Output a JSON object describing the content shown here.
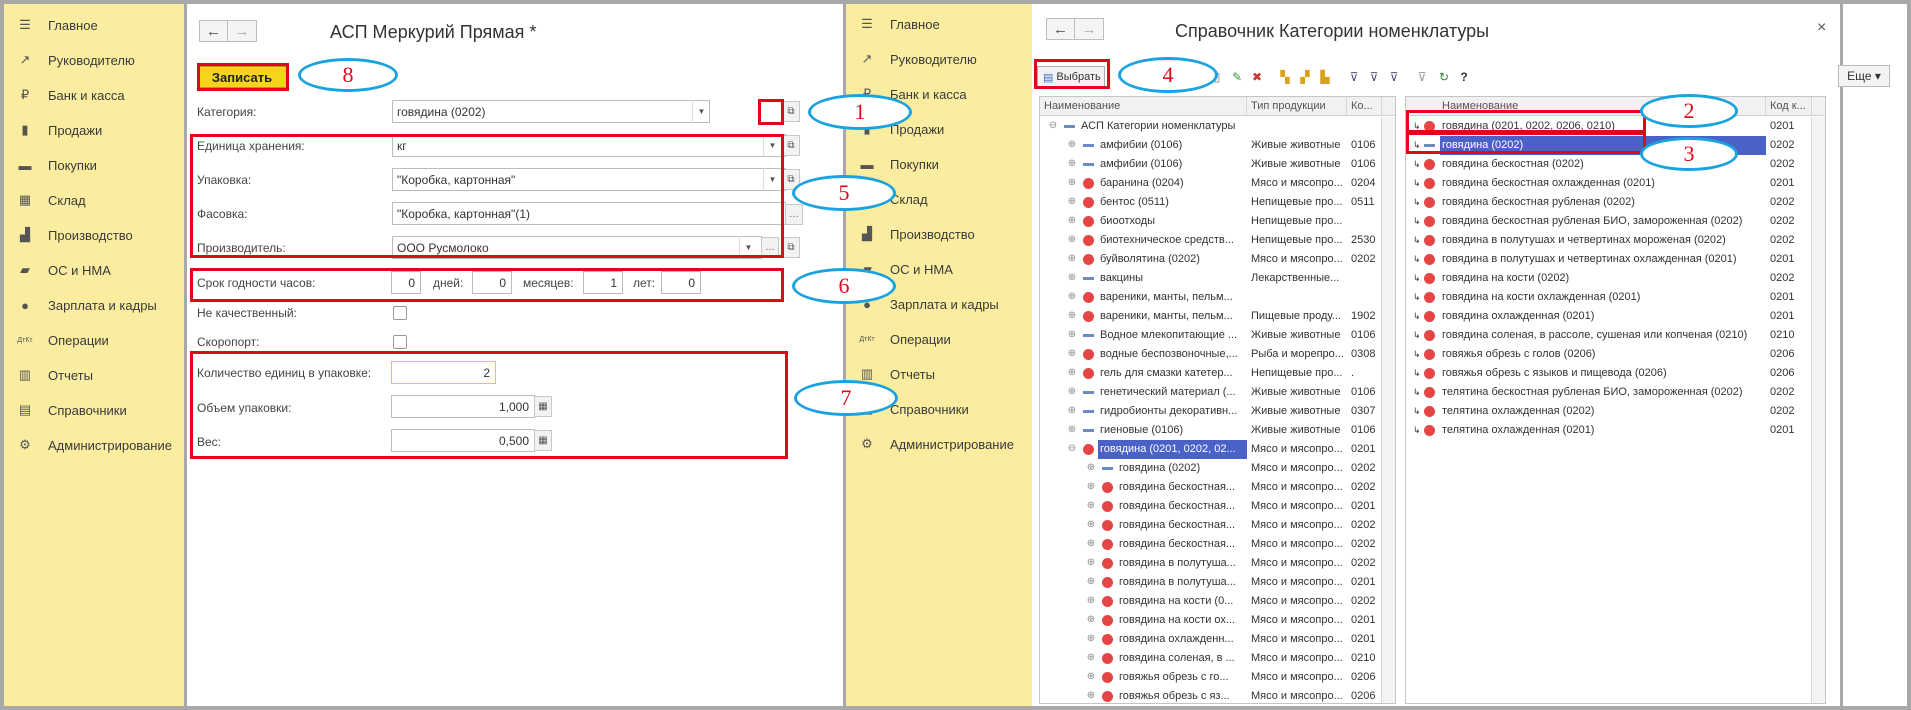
{
  "left_sidebar": {
    "items": [
      {
        "icon": "menu-icon",
        "glyph": "☰",
        "label": "Главное"
      },
      {
        "icon": "chart-trend-icon",
        "glyph": "↗",
        "label": "Руководителю"
      },
      {
        "icon": "coin-icon",
        "glyph": "₽",
        "label": "Банк и касса"
      },
      {
        "icon": "bag-icon",
        "glyph": "▮",
        "label": "Продажи"
      },
      {
        "icon": "cart-icon",
        "glyph": "▬",
        "label": "Покупки"
      },
      {
        "icon": "grid-icon",
        "glyph": "▦",
        "label": "Склад"
      },
      {
        "icon": "factory-icon",
        "glyph": "▟",
        "label": "Производство"
      },
      {
        "icon": "truck-icon",
        "glyph": "▰",
        "label": "ОС и НМА"
      },
      {
        "icon": "person-icon",
        "glyph": "●",
        "label": "Зарплата и кадры"
      },
      {
        "icon": "dt-kt-icon",
        "glyph": "ДтКт",
        "label": "Операции"
      },
      {
        "icon": "bar-chart-icon",
        "glyph": "▥",
        "label": "Отчеты"
      },
      {
        "icon": "book-icon",
        "glyph": "▤",
        "label": "Справочники"
      },
      {
        "icon": "gear-icon",
        "glyph": "⚙",
        "label": "Администрирование"
      }
    ]
  },
  "form": {
    "title": "АСП Меркурий Прямая *",
    "save_label": "Записать",
    "category_label": "Категория:",
    "category_value": "говядина (0202)",
    "unit_label": "Единица хранения:",
    "unit_value": "кг",
    "package_label": "Упаковка:",
    "package_value": "\"Коробка, картонная\"",
    "packing_label": "Фасовка:",
    "packing_value": "\"Коробка, картонная\"(1)",
    "producer_label": "Производитель:",
    "producer_value": "ООО Русмолоко",
    "shelf_label": "Срок годности часов:",
    "shelf_hours": "0",
    "days_label": "дней:",
    "days_value": "0",
    "months_label": "месяцев:",
    "months_value": "1",
    "years_label": "лет:",
    "years_value": "0",
    "not_quality_label": "Не качественный:",
    "perishable_label": "Скоропорт:",
    "qty_label": "Количество единиц в упаковке:",
    "qty_value": "2",
    "volume_label": "Объем упаковки:",
    "volume_value": "1,000",
    "weight_label": "Вес:",
    "weight_value": "0,500"
  },
  "dialog": {
    "title": "Справочник Категории номенклатуры",
    "close": "×",
    "select_label": "Выбрать",
    "help": "?",
    "more_label": "Еще ▾",
    "left_table": {
      "headers": [
        "Наименование",
        "Тип продукции",
        "Ко..."
      ],
      "rows": [
        {
          "name": "АСП Категории номенклатуры",
          "type": "",
          "code": "",
          "level": 0,
          "kind": "root"
        },
        {
          "name": "амфибии (0106)",
          "type": "Живые животные",
          "code": "0106",
          "level": 1,
          "kind": "dash"
        },
        {
          "name": "амфибии (0106)",
          "type": "Живые животные",
          "code": "0106",
          "level": 1,
          "kind": "dash"
        },
        {
          "name": "баранина (0204)",
          "type": "Мясо и мясопро...",
          "code": "0204",
          "level": 1,
          "kind": "red"
        },
        {
          "name": "бентос (0511)",
          "type": "Непищевые про...",
          "code": "0511",
          "level": 1,
          "kind": "red"
        },
        {
          "name": "биоотходы",
          "type": "Непищевые про...",
          "code": "",
          "level": 1,
          "kind": "red"
        },
        {
          "name": "биотехническое средств...",
          "type": "Непищевые про...",
          "code": "2530",
          "level": 1,
          "kind": "red"
        },
        {
          "name": "буйволятина (0202)",
          "type": "Мясо и мясопро...",
          "code": "0202",
          "level": 1,
          "kind": "red"
        },
        {
          "name": "вакцины",
          "type": "Лекарственные...",
          "code": "",
          "level": 1,
          "kind": "dash"
        },
        {
          "name": "вареники, манты, пельм...",
          "type": "",
          "code": "",
          "level": 1,
          "kind": "red"
        },
        {
          "name": "вареники, манты, пельм...",
          "type": "Пищевые проду...",
          "code": "1902",
          "level": 1,
          "kind": "red"
        },
        {
          "name": "Водное млекопитающие ...",
          "type": "Живые животные",
          "code": "0106",
          "level": 1,
          "kind": "dash"
        },
        {
          "name": "водные беспозвоночные,...",
          "type": "Рыба и морепро...",
          "code": "0308",
          "level": 1,
          "kind": "red"
        },
        {
          "name": "гель для смазки катетер...",
          "type": "Непищевые про...",
          "code": ".",
          "level": 1,
          "kind": "red"
        },
        {
          "name": "генетический материал (...",
          "type": "Живые животные",
          "code": "0106",
          "level": 1,
          "kind": "dash"
        },
        {
          "name": "гидробионты декоративн...",
          "type": "Живые животные",
          "code": "0307",
          "level": 1,
          "kind": "dash"
        },
        {
          "name": "гиеновые (0106)",
          "type": "Живые животные",
          "code": "0106",
          "level": 1,
          "kind": "dash"
        },
        {
          "name": "говядина (0201, 0202, 02...",
          "type": "Мясо и мясопро...",
          "code": "0201",
          "level": 1,
          "kind": "red",
          "selected": true,
          "open": true
        },
        {
          "name": "говядина (0202)",
          "type": "Мясо и мясопро...",
          "code": "0202",
          "level": 2,
          "kind": "dash"
        },
        {
          "name": "говядина бескостная...",
          "type": "Мясо и мясопро...",
          "code": "0202",
          "level": 2,
          "kind": "red"
        },
        {
          "name": "говядина бескостная...",
          "type": "Мясо и мясопро...",
          "code": "0201",
          "level": 2,
          "kind": "red"
        },
        {
          "name": "говядина бескостная...",
          "type": "Мясо и мясопро...",
          "code": "0202",
          "level": 2,
          "kind": "red"
        },
        {
          "name": "говядина бескостная...",
          "type": "Мясо и мясопро...",
          "code": "0202",
          "level": 2,
          "kind": "red"
        },
        {
          "name": "говядина в полутуша...",
          "type": "Мясо и мясопро...",
          "code": "0202",
          "level": 2,
          "kind": "red"
        },
        {
          "name": "говядина в полутуша...",
          "type": "Мясо и мясопро...",
          "code": "0201",
          "level": 2,
          "kind": "red"
        },
        {
          "name": "говядина на кости (0...",
          "type": "Мясо и мясопро...",
          "code": "0202",
          "level": 2,
          "kind": "red"
        },
        {
          "name": "говядина на кости ох...",
          "type": "Мясо и мясопро...",
          "code": "0201",
          "level": 2,
          "kind": "red"
        },
        {
          "name": "говядина охлажденн...",
          "type": "Мясо и мясопро...",
          "code": "0201",
          "level": 2,
          "kind": "red"
        },
        {
          "name": "говядина соленая, в ...",
          "type": "Мясо и мясопро...",
          "code": "0210",
          "level": 2,
          "kind": "red"
        },
        {
          "name": "говяжья обрезь с го...",
          "type": "Мясо и мясопро...",
          "code": "0206",
          "level": 2,
          "kind": "red"
        },
        {
          "name": "говяжья обрезь с яз...",
          "type": "Мясо и мясопро...",
          "code": "0206",
          "level": 2,
          "kind": "red"
        }
      ]
    },
    "right_table": {
      "headers": [
        "Наименование",
        "Код к..."
      ],
      "rows": [
        {
          "name": "говядина (0201, 0202, 0206, 0210)",
          "code": "0201",
          "kind": "red"
        },
        {
          "name": "говядина (0202)",
          "code": "0202",
          "kind": "dash",
          "selected": true
        },
        {
          "name": "говядина бескостная (0202)",
          "code": "0202",
          "kind": "red"
        },
        {
          "name": "говядина бескостная охлажденная (0201)",
          "code": "0201",
          "kind": "red"
        },
        {
          "name": "говядина бескостная рубленая (0202)",
          "code": "0202",
          "kind": "red"
        },
        {
          "name": "говядина бескостная рубленая БИО, замороженная (0202)",
          "code": "0202",
          "kind": "red"
        },
        {
          "name": "говядина в полутушах и четвертинах мороженая (0202)",
          "code": "0202",
          "kind": "red"
        },
        {
          "name": "говядина в полутушах и четвертинах охлажденная (0201)",
          "code": "0201",
          "kind": "red"
        },
        {
          "name": "говядина на кости (0202)",
          "code": "0202",
          "kind": "red"
        },
        {
          "name": "говядина на кости охлажденная (0201)",
          "code": "0201",
          "kind": "red"
        },
        {
          "name": "говядина охлажденная (0201)",
          "code": "0201",
          "kind": "red"
        },
        {
          "name": "говядина соленая, в рассоле, сушеная или копченая (0210)",
          "code": "0210",
          "kind": "red"
        },
        {
          "name": "говяжья обрезь с голов (0206)",
          "code": "0206",
          "kind": "red"
        },
        {
          "name": "говяжья обрезь с языков и пищевода (0206)",
          "code": "0206",
          "kind": "red"
        },
        {
          "name": "телятина бескостная рубленая БИО, замороженная (0202)",
          "code": "0202",
          "kind": "red"
        },
        {
          "name": "телятина охлажденная (0202)",
          "code": "0202",
          "kind": "red"
        },
        {
          "name": "телятина охлажденная (0201)",
          "code": "0201",
          "kind": "red"
        }
      ]
    }
  },
  "annotations": [
    "1",
    "2",
    "3",
    "4",
    "5",
    "6",
    "7",
    "8"
  ],
  "colors": {
    "sidebar": "#fbeda0",
    "annotation_red": "#e2061b",
    "annotation_blue": "#1aa3df",
    "save_yellow": "#f6d31c",
    "selection": "#4a62c8"
  }
}
